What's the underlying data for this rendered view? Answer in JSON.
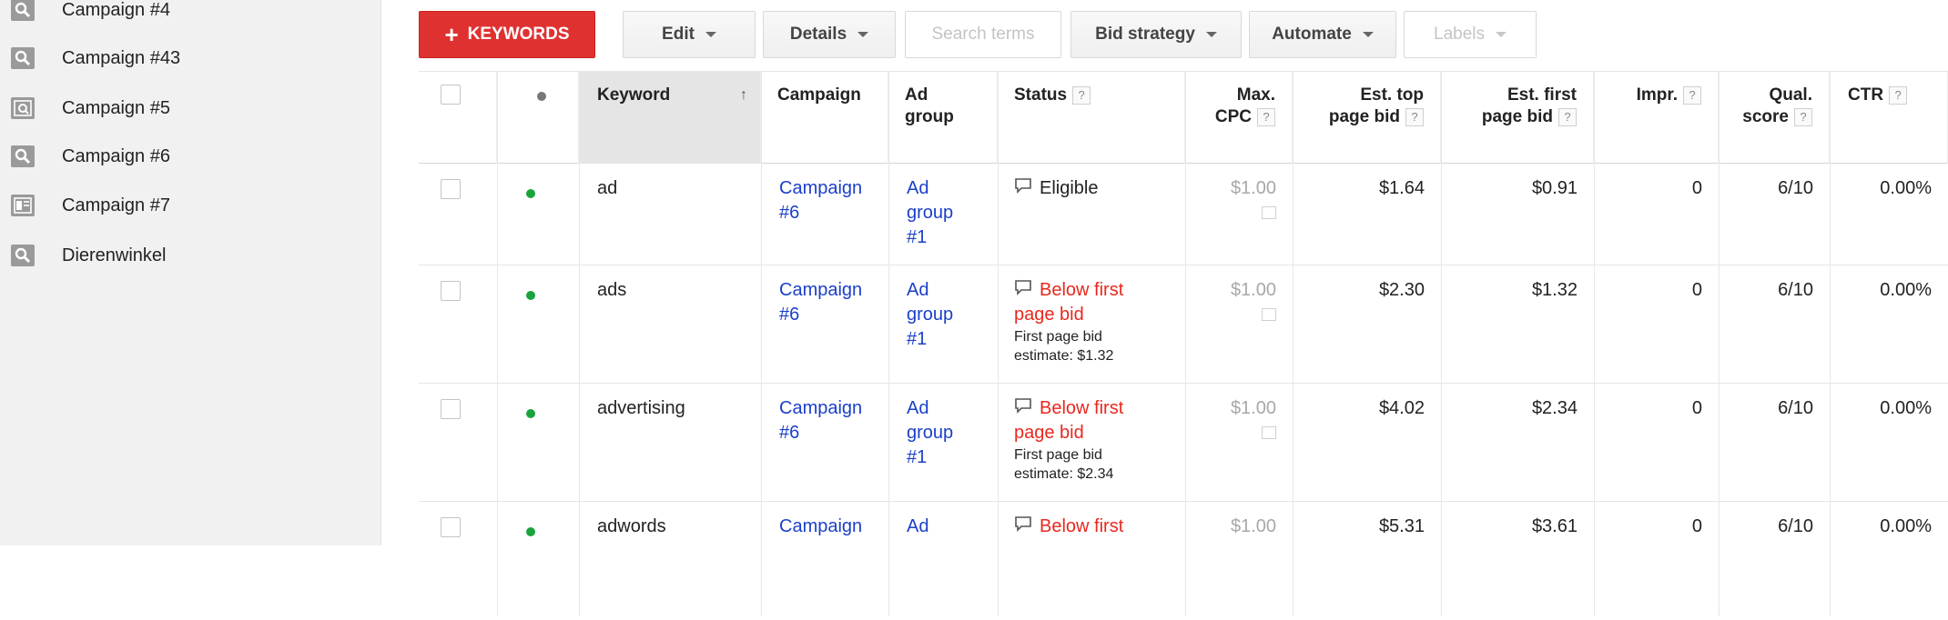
{
  "sidebar": {
    "items": [
      {
        "label": "Campaign #4",
        "icon": "search-icon"
      },
      {
        "label": "Campaign #43",
        "icon": "search-icon"
      },
      {
        "label": "Campaign #5",
        "icon": "display-search-icon"
      },
      {
        "label": "Campaign #6",
        "icon": "search-icon"
      },
      {
        "label": "Campaign #7",
        "icon": "display-icon"
      },
      {
        "label": "Dierenwinkel",
        "icon": "search-icon"
      }
    ]
  },
  "toolbar": {
    "keywords_label": "KEYWORDS",
    "edit_label": "Edit",
    "details_label": "Details",
    "search_terms_label": "Search terms",
    "bid_strategy_label": "Bid strategy",
    "automate_label": "Automate",
    "labels_label": "Labels"
  },
  "table": {
    "headers": {
      "keyword": "Keyword",
      "campaign": "Campaign",
      "ad_group_line1": "Ad",
      "ad_group_line2": "group",
      "status": "Status",
      "max_cpc_line1": "Max.",
      "max_cpc_line2": "CPC",
      "est_top_line1": "Est. top",
      "est_top_line2": "page bid",
      "est_first_line1": "Est. first",
      "est_first_line2": "page bid",
      "impr": "Impr.",
      "qual_line1": "Qual.",
      "qual_line2": "score",
      "ctr": "CTR",
      "help": "?"
    },
    "rows": [
      {
        "keyword": "ad",
        "campaign_line1": "Campaign",
        "campaign_line2": "#6",
        "ad_group_line1": "Ad",
        "ad_group_line2": "group",
        "ad_group_line3": "#1",
        "status": "Eligible",
        "status_line2": "",
        "status_sub1": "",
        "status_sub2": "",
        "max_cpc": "$1.00",
        "est_top": "$1.64",
        "est_first": "$0.91",
        "impr": "0",
        "qual": "6/10",
        "ctr": "0.00%"
      },
      {
        "keyword": "ads",
        "campaign_line1": "Campaign",
        "campaign_line2": "#6",
        "ad_group_line1": "Ad",
        "ad_group_line2": "group",
        "ad_group_line3": "#1",
        "status": "Below first",
        "status_line2": "page bid",
        "status_sub1": "First page bid",
        "status_sub2": "estimate: $1.32",
        "max_cpc": "$1.00",
        "est_top": "$2.30",
        "est_first": "$1.32",
        "impr": "0",
        "qual": "6/10",
        "ctr": "0.00%"
      },
      {
        "keyword": "advertising",
        "campaign_line1": "Campaign",
        "campaign_line2": "#6",
        "ad_group_line1": "Ad",
        "ad_group_line2": "group",
        "ad_group_line3": "#1",
        "status": "Below first",
        "status_line2": "page bid",
        "status_sub1": "First page bid",
        "status_sub2": "estimate: $2.34",
        "max_cpc": "$1.00",
        "est_top": "$4.02",
        "est_first": "$2.34",
        "impr": "0",
        "qual": "6/10",
        "ctr": "0.00%"
      },
      {
        "keyword": "adwords",
        "campaign_line1": "Campaign",
        "campaign_line2": "",
        "ad_group_line1": "Ad",
        "ad_group_line2": "",
        "ad_group_line3": "",
        "status": "Below first",
        "status_line2": "",
        "status_sub1": "",
        "status_sub2": "",
        "max_cpc": "$1.00",
        "est_top": "$5.31",
        "est_first": "$3.61",
        "impr": "0",
        "qual": "6/10",
        "ctr": "0.00%"
      }
    ]
  },
  "colors": {
    "keywords_button": "#e03131",
    "link": "#1a3fc8",
    "status_warning": "#e8281e",
    "enabled_dot": "#1aa33c"
  }
}
